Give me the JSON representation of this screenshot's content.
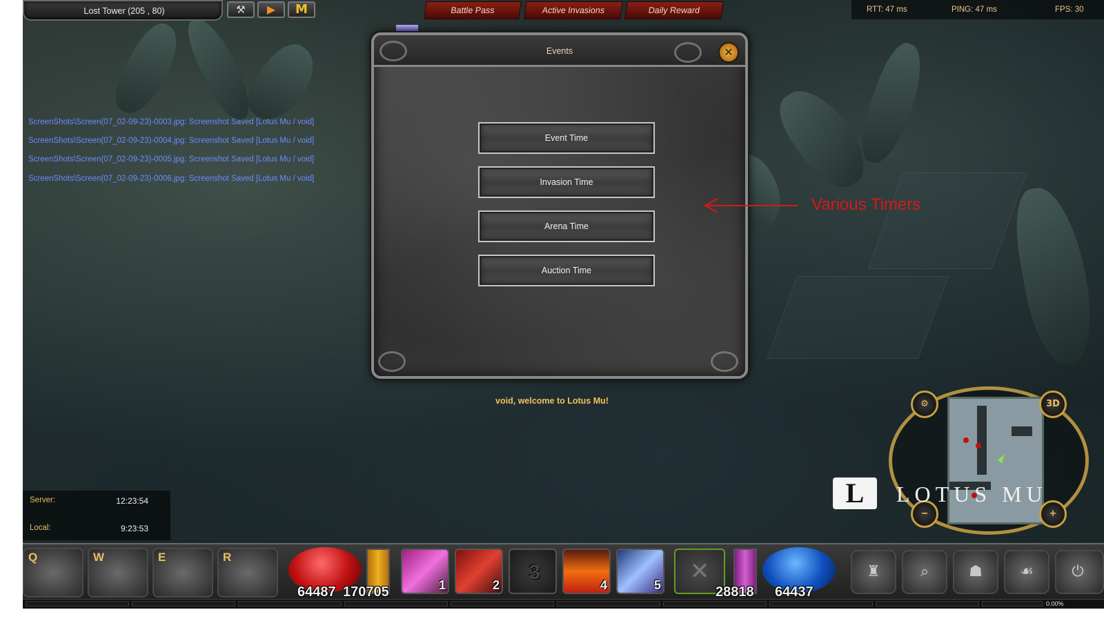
{
  "location": {
    "text": "Lost Tower (205 , 80)"
  },
  "toolbar": {
    "tool_icon": "wrench-icon",
    "play_icon": "play-icon",
    "mail_icon": "m-icon"
  },
  "top_menu": {
    "battle_pass": "Battle Pass",
    "active_invasions": "Active Invasions",
    "daily_reward": "Daily Reward"
  },
  "stats": {
    "rtt": "RTT: 47 ms",
    "ping": "PING: 47 ms",
    "fps": "FPS: 30"
  },
  "chat": {
    "lines": [
      "ScreenShots\\Screen(07_02-09-23)-0003.jpg: Screenshot Saved [Lotus Mu / void]",
      "ScreenShots\\Screen(07_02-09-23)-0004.jpg: Screenshot Saved [Lotus Mu / void]",
      "ScreenShots\\Screen(07_02-09-23)-0005.jpg: Screenshot Saved [Lotus Mu / void]",
      "ScreenShots\\Screen(07_02-09-23)-0006.jpg: Screenshot Saved [Lotus Mu / void]"
    ]
  },
  "events_window": {
    "title": "Events",
    "buttons": [
      "Event Time",
      "Invasion Time",
      "Arena Time",
      "Auction Time"
    ]
  },
  "annotation": {
    "text": "Various Timers",
    "color": "#d81818"
  },
  "welcome": "void, welcome to Lotus Mu!",
  "clock": {
    "server_label": "Server:",
    "server_time": "12:23:54",
    "local_label": "Local:",
    "local_time": "9:23:53"
  },
  "minimap": {
    "brand_letter": "L",
    "brand_name": "LOTUS MU",
    "zoom_out": "−",
    "zoom_in": "+",
    "mode_3d": "3D"
  },
  "hotkeys": [
    "Q",
    "W",
    "E",
    "R"
  ],
  "hud": {
    "hp": "64487",
    "ag": "170705",
    "sd": "28818",
    "mp": "64437"
  },
  "skills": [
    "1",
    "2",
    "3",
    "4",
    "5"
  ],
  "exp": {
    "percent": "0.00%"
  },
  "colors": {
    "accent_gold": "#e8c060",
    "chat_blue": "#6a8cff",
    "tab_red": "#8a1f14"
  }
}
